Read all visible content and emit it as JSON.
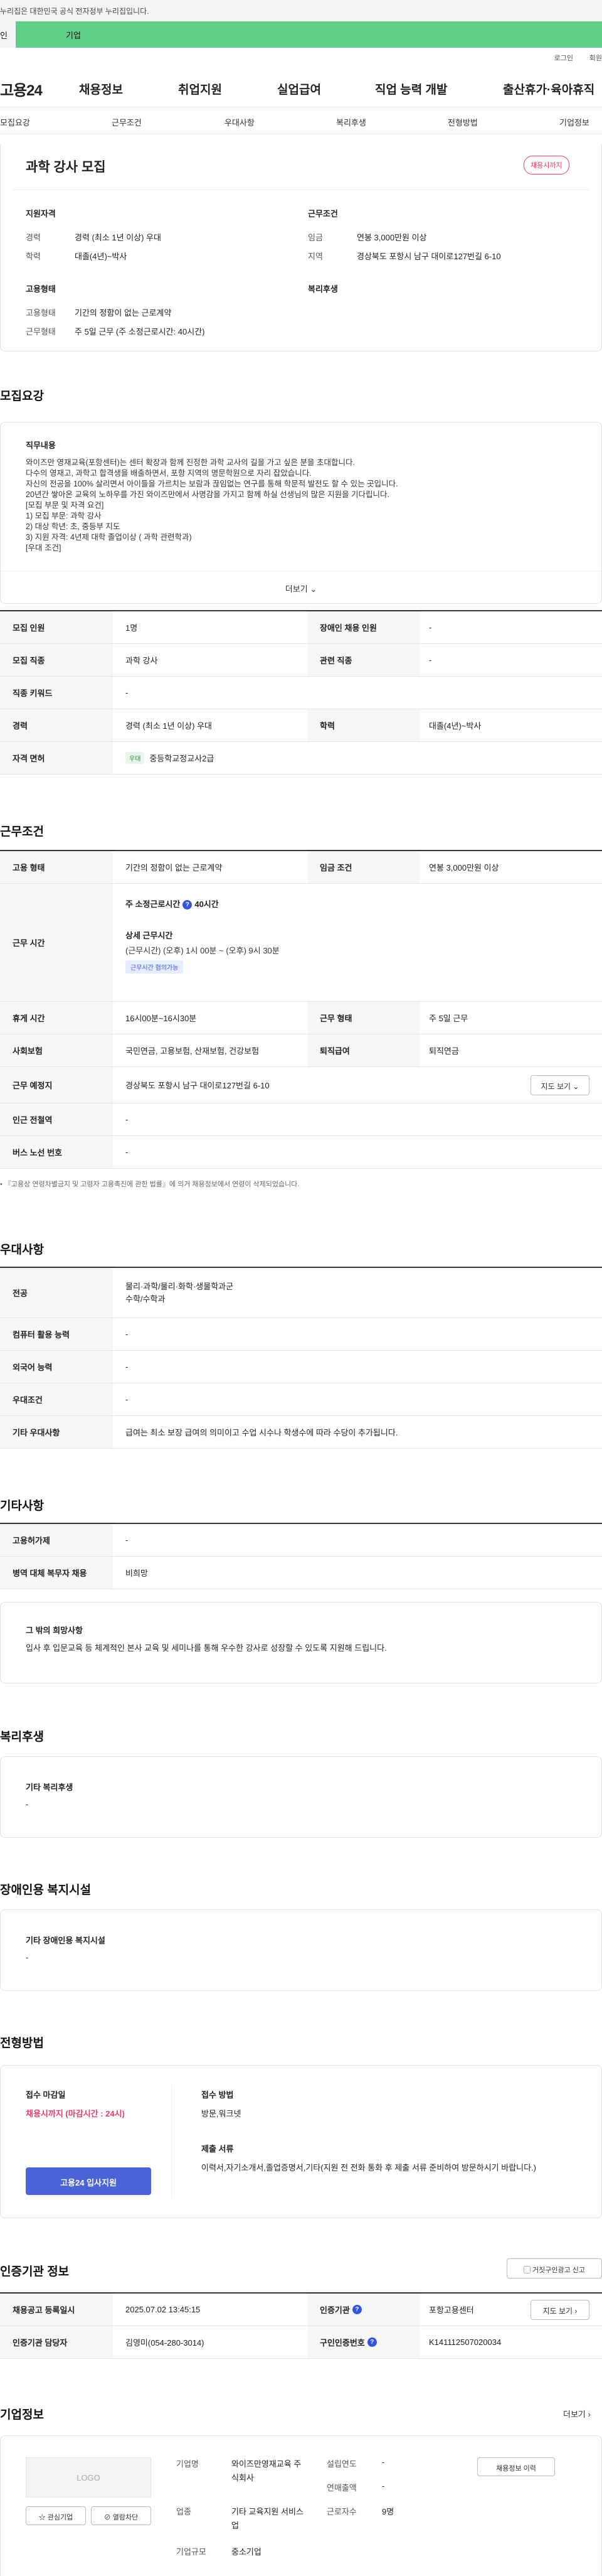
{
  "gov_banner": "누리집은 대한민국 공식 전자정부 누리집입니다.",
  "top_tabs": {
    "individual": "인",
    "business": "기업"
  },
  "util": {
    "login": "로그인",
    "join": "회원"
  },
  "logo": "고용24",
  "main_nav": [
    "채용정보",
    "취업지원",
    "실업급여",
    "직업 능력 개발",
    "출산휴가·육아휴직"
  ],
  "sub_nav": [
    "모집요강",
    "근무조건",
    "우대사항",
    "복리후생",
    "전형방법",
    "기업정보"
  ],
  "summary": {
    "title": "과학 강사 모집",
    "status": "채용시까지",
    "qual_heading": "지원자격",
    "cond_heading": "근무조건",
    "emp_heading": "고용형태",
    "welfare_heading": "복리후생",
    "career_label": "경력",
    "career_value": "경력 (최소 1년 이상) 우대",
    "edu_label": "학력",
    "edu_value": "대졸(4년)~박사",
    "wage_label": "임금",
    "wage_value": "연봉 3,000만원 이상",
    "region_label": "지역",
    "region_value": "경상북도 포항시 남구 대이로127번길 6-10",
    "emptype_label": "고용형태",
    "emptype_value": "기간의 정함이 없는 근로계약",
    "worktype_label": "근무형태",
    "worktype_value": "주 5일 근무 (주 소정근로시간: 40시간)"
  },
  "recruit": {
    "title": "모집요강",
    "job_heading": "직무내용",
    "lines": [
      "와이즈만 영재교육(포항센터)는 센터 확장과 함께 진정한  과학 교사의 길을 가고 싶은 분을 초대합니다.",
      "다수의 영재고, 과학고 합격생을 배출하면서, 포항 지역의 명문학원으로 자리 잡았습니다.",
      "자신의 전공을 100% 살리면서 아이들을 가르치는 보람과 끊임없는 연구를 통해 학문적 발전도 할 수 있는 곳입니다.",
      "20년간 쌓아온 교육의 노하우를 가진 와이즈만에서 사명감을 가지고 함께 하실 선생님의 많은 지원을 기다립니다.",
      "[모집 부문 및 자격 요건]",
      "1) 모집 부문: 과학 강사",
      "2) 대상 학년: 초, 중등부 지도",
      "3) 지원 자격: 4년제 대학 졸업이상 ( 과학 관련학과)",
      "[우대 조건]"
    ],
    "more": "더보기",
    "rows": [
      {
        "l1": "모집 인원",
        "v1": "1명",
        "l2": "장애인 채용 인원",
        "v2": "-"
      },
      {
        "l1": "모집 직종",
        "v1": "과학 강사",
        "l2": "관련 직종",
        "v2": "-"
      },
      {
        "l1": "직종 키워드",
        "v1": "-"
      },
      {
        "l1": "경력",
        "v1": "경력 (최소 1년 이상) 우대",
        "l2": "학력",
        "v2": "대졸(4년)~박사"
      },
      {
        "l1": "자격 면허",
        "badge": "우대",
        "v1": "중등학교정교사2급"
      }
    ]
  },
  "conditions": {
    "title": "근무조건",
    "emp_label": "고용 형태",
    "emp_value": "기간의 정함이 없는 근로계약",
    "wage_label": "임금 조건",
    "wage_value": "연봉 3,000만원 이상",
    "time_label": "근무 시간",
    "weekly": "주 소정근로시간",
    "weekly_hours": "40시간",
    "detail_heading": "상세 근무시간",
    "detail": "(근무시간) (오후) 1시 00분 ~ (오후) 9시 30분",
    "flex_badge": "근무시간 협의가능",
    "break_label": "휴게 시간",
    "break_value": "16시00분~16시30분",
    "form_label": "근무 형태",
    "form_value": "주 5일 근무",
    "ins_label": "사회보험",
    "ins_value": "국민연금, 고용보험, 산재보험, 건강보험",
    "ret_label": "퇴직급여",
    "ret_value": "퇴직연금",
    "place_label": "근무 예정지",
    "place_value": "경상북도 포항시 남구 대이로127번길 6-10",
    "map_btn": "지도 보기",
    "sub_label": "인근 전철역",
    "sub_value": "-",
    "bus_label": "버스 노선 번호",
    "bus_value": "-",
    "note": "『고용상 연령차별금지 및 고령자 고용촉진에 관한 법률』에 의거 채용정보에서 연령이 삭제되었습니다."
  },
  "pref": {
    "title": "우대사항",
    "major_label": "전공",
    "major_values": [
      "물리·과학/물리·화학·생물학과군",
      "수학/수학과"
    ],
    "pc_label": "컴퓨터 활용 능력",
    "pc_value": "-",
    "lang_label": "외국어 능력",
    "lang_value": "-",
    "cond_label": "우대조건",
    "cond_value": "-",
    "etc_label": "기타 우대사항",
    "etc_value": "급여는 최소 보장 급여의 의미이고 수업 시수나 학생수에 따라 수당이 추가됩니다."
  },
  "other": {
    "title": "기타사항",
    "hire_label": "고용허가제",
    "hire_value": "-",
    "mil_label": "병역 대체 복무자 채용",
    "mil_value": "비희망",
    "wish_heading": "그 밖의 희망사항",
    "wish_value": "입사 후 입문교육 등 체계적인 본사 교육 및 세미나를 통해 우수한 강사로 성장할 수 있도록 지원해 드립니다."
  },
  "welfare": {
    "title": "복리후생",
    "heading": "기타 복리후생",
    "value": "-"
  },
  "disability": {
    "title": "장애인용 복지시설",
    "heading": "기타 장애인용 복지시설",
    "value": "-"
  },
  "selection": {
    "title": "전형방법",
    "deadline_heading": "접수 마감일",
    "deadline_value": "채용시까지 (마감시간 : 24시)",
    "method_heading": "접수 방법",
    "method_value": "방문,워크넷",
    "docs_heading": "제출 서류",
    "docs_value": "이력서,자기소개서,졸업증명서,기타(지원 전 전화 통화 후 제출 서류 준비하여 방문하시기 바랍니다.)",
    "apply_btn": "고용24 입사지원"
  },
  "cert": {
    "title": "인증기관 정보",
    "report_btn": "거짓구인광고 신고",
    "date_label": "채용공고 등록일시",
    "date_value": "2025.07.02 13:45:15",
    "org_label": "인증기관",
    "org_value": "포항고용센터",
    "map_btn": "지도 보기",
    "mgr_label": "인증기관 담당자",
    "mgr_value": "김영미(054-280-3014)",
    "num_label": "구인인증번호",
    "num_value": "K141112507020034"
  },
  "company": {
    "title": "기업정보",
    "more": "더보기",
    "logo_text": "LOGO",
    "fav_btn": "관심기업",
    "block_btn": "열람차단",
    "name_label": "기업명",
    "name_value": "와이즈만영재교육 주식회사",
    "ind_label": "업종",
    "ind_value": "기타 교육지원 서비스업",
    "size_label": "기업규모",
    "size_value": "중소기업",
    "year_label": "설립연도",
    "year_value": "-",
    "sales_label": "연매출액",
    "sales_value": "-",
    "emp_label": "근로자수",
    "emp_value": "9명",
    "hist_btn": "채용정보 이력"
  }
}
